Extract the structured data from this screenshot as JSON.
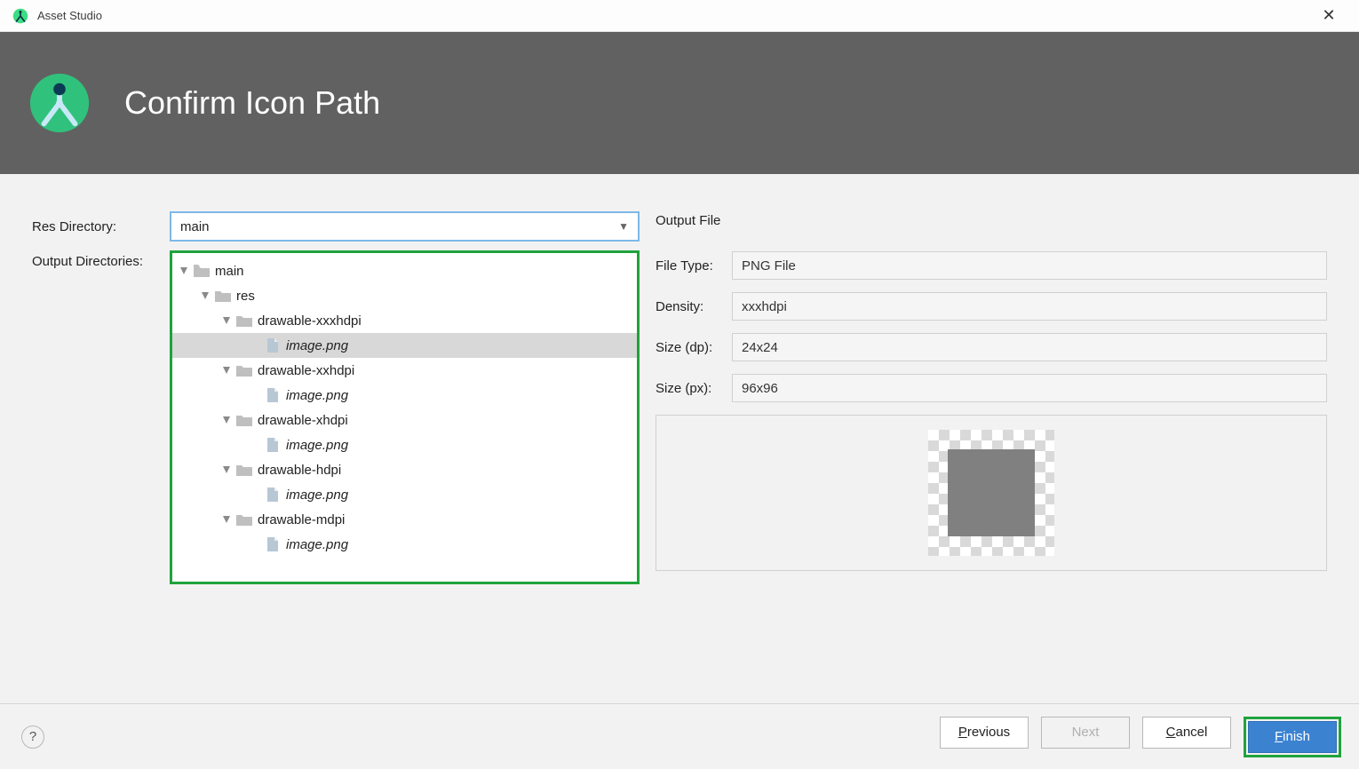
{
  "window": {
    "title": "Asset Studio"
  },
  "header": {
    "title": "Confirm Icon Path"
  },
  "left": {
    "res_dir_label": "Res Directory:",
    "output_dirs_label": "Output Directories:",
    "res_dir_value": "main"
  },
  "tree": {
    "main": "main",
    "res": "res",
    "folders": [
      "drawable-xxxhdpi",
      "drawable-xxhdpi",
      "drawable-xhdpi",
      "drawable-hdpi",
      "drawable-mdpi"
    ],
    "file": "image.png"
  },
  "right": {
    "heading": "Output File",
    "file_type_label": "File Type:",
    "file_type_value": "PNG File",
    "density_label": "Density:",
    "density_value": "xxxhdpi",
    "size_dp_label": "Size (dp):",
    "size_dp_value": "24x24",
    "size_px_label": "Size (px):",
    "size_px_value": "96x96"
  },
  "footer": {
    "previous": "Previous",
    "next": "Next",
    "cancel": "Cancel",
    "finish": "Finish"
  }
}
